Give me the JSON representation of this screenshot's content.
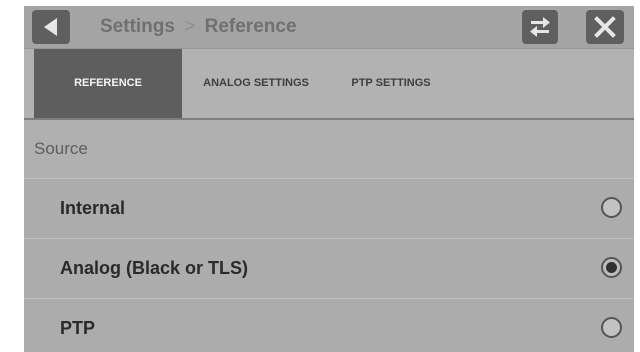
{
  "header": {
    "breadcrumb_parent": "Settings",
    "breadcrumb_separator": ">",
    "breadcrumb_current": "Reference",
    "back_icon": "back-arrow-icon",
    "swap_icon": "swap-arrows-icon",
    "close_icon": "close-x-icon"
  },
  "tabs": [
    {
      "label": "REFERENCE",
      "active": true
    },
    {
      "label": "ANALOG SETTINGS",
      "active": false
    },
    {
      "label": "PTP SETTINGS",
      "active": false
    }
  ],
  "source": {
    "heading": "Source",
    "options": [
      {
        "label": "Internal",
        "selected": false
      },
      {
        "label": "Analog (Black or TLS)",
        "selected": true
      },
      {
        "label": "PTP",
        "selected": false
      }
    ]
  },
  "colors": {
    "background": "#acacac",
    "active_tab": "#5e5e5e",
    "button": "#5f5f5f"
  }
}
